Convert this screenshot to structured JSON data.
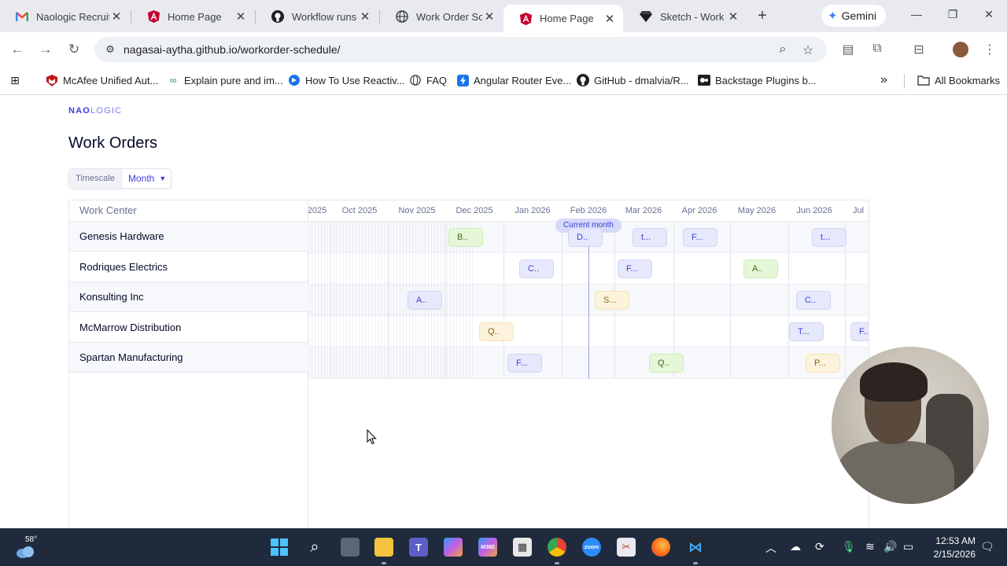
{
  "browser": {
    "tabs": [
      {
        "label": "Naologic Recruit",
        "favicon": "gmail-icon",
        "active": false
      },
      {
        "label": "Home Page",
        "favicon": "angular-icon",
        "active": false
      },
      {
        "label": "Workflow runs ·",
        "favicon": "github-icon",
        "active": false
      },
      {
        "label": "Work Order Sch",
        "favicon": "globe-icon",
        "active": false
      },
      {
        "label": "Home Page",
        "favicon": "angular-icon",
        "active": true
      },
      {
        "label": "Sketch - Work O",
        "favicon": "sketch-icon",
        "active": false
      }
    ],
    "gemini_label": "Gemini",
    "url_host": "nagasai-aytha.github.io",
    "url_path": "/workorder-schedule/",
    "bookmarks": [
      {
        "label": "McAfee Unified Aut...",
        "icon": "mcafee-icon"
      },
      {
        "label": "Explain pure and im...",
        "icon": "link-icon"
      },
      {
        "label": "How To Use Reactiv...",
        "icon": "reactive-icon"
      },
      {
        "label": "FAQ",
        "icon": "globe-icon"
      },
      {
        "label": "Angular Router Eve...",
        "icon": "bolt-icon"
      },
      {
        "label": "GitHub - dmalvia/R...",
        "icon": "github-icon"
      },
      {
        "label": "Backstage Plugins b...",
        "icon": "backstage-icon"
      }
    ],
    "more_bookmarks": "»",
    "all_bookmarks": "All Bookmarks"
  },
  "app": {
    "logo_bold": "NAO",
    "logo_light": "LOGIC",
    "title": "Work Orders",
    "timescale_label": "Timescale",
    "timescale_value": "Month",
    "work_center_header": "Work Center",
    "work_centers": [
      "Genesis Hardware",
      "Rodriques Electrics",
      "Konsulting Inc",
      "McMarrow Distribution",
      "Spartan Manufacturing"
    ],
    "months": [
      "2025",
      "Oct 2025",
      "Nov 2025",
      "Dec 2025",
      "Jan 2026",
      "Feb 2026",
      "Mar 2026",
      "Apr 2026",
      "May 2026",
      "Jun 2026",
      "Jul"
    ],
    "current_month_label": "Current month",
    "orders": [
      {
        "row": 0,
        "label": "B..",
        "status": "green"
      },
      {
        "row": 0,
        "label": "D..",
        "status": "purple"
      },
      {
        "row": 0,
        "label": "t...",
        "status": "purple"
      },
      {
        "row": 0,
        "label": "F...",
        "status": "purple"
      },
      {
        "row": 0,
        "label": "t...",
        "status": "purple"
      },
      {
        "row": 1,
        "label": "C..",
        "status": "purple"
      },
      {
        "row": 1,
        "label": "F...",
        "status": "purple"
      },
      {
        "row": 1,
        "label": "A..",
        "status": "green"
      },
      {
        "row": 2,
        "label": "A..",
        "status": "purple"
      },
      {
        "row": 2,
        "label": "S...",
        "status": "yellow"
      },
      {
        "row": 2,
        "label": "C..",
        "status": "purple"
      },
      {
        "row": 3,
        "label": "Q..",
        "status": "yellow"
      },
      {
        "row": 3,
        "label": "T...",
        "status": "purple"
      },
      {
        "row": 3,
        "label": "F...",
        "status": "purple"
      },
      {
        "row": 4,
        "label": "F...",
        "status": "purple"
      },
      {
        "row": 4,
        "label": "Q..",
        "status": "green"
      },
      {
        "row": 4,
        "label": "P...",
        "status": "yellow"
      }
    ]
  },
  "taskbar": {
    "weather_temp": "58°",
    "time": "12:53 AM",
    "date": "2/15/2026"
  },
  "colors": {
    "accent": "#3e40db",
    "status_green": "#e5f7d8",
    "status_purple": "#e6e8fb",
    "status_yellow": "#fcf3dc"
  }
}
